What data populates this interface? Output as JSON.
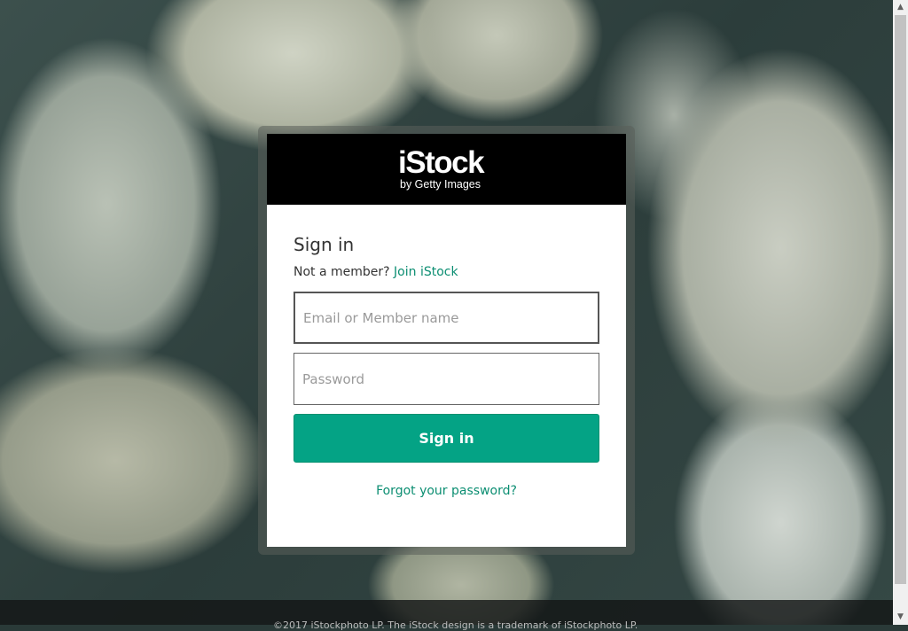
{
  "brand": {
    "logo": "iStock",
    "tagline": "by Getty Images"
  },
  "signin": {
    "title": "Sign in",
    "not_member": "Not a member?",
    "join_link": "Join iStock",
    "email_placeholder": "Email or Member name",
    "password_placeholder": "Password",
    "submit_label": "Sign in",
    "forgot_link": "Forgot your password?"
  },
  "footer": {
    "text": "©2017 iStockphoto LP. The iStock design is a trademark of iStockphoto LP."
  },
  "colors": {
    "accent": "#04a385",
    "link": "#0c8e72",
    "header_bg": "#000000"
  }
}
